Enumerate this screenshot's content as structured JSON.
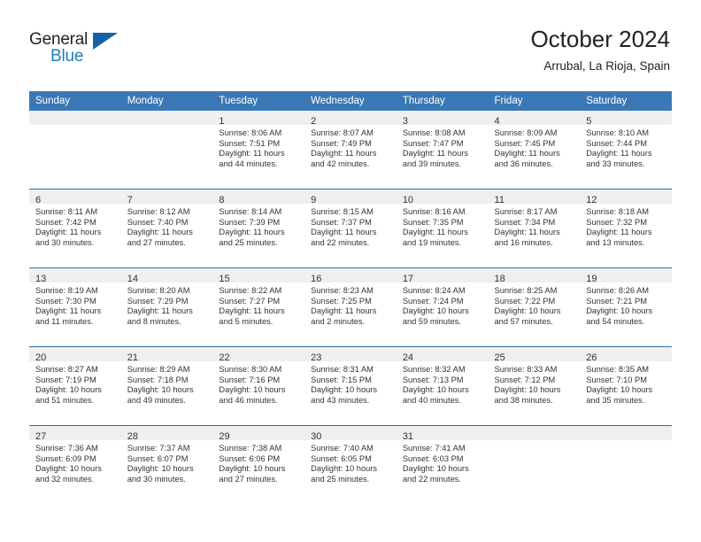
{
  "brand": {
    "word_one": "General",
    "word_two": "Blue",
    "triangle_icon": "triangle-icon"
  },
  "header": {
    "title": "October 2024",
    "subtitle": "Arrubal, La Rioja, Spain"
  },
  "colors": {
    "header_blue": "#3a78b5",
    "row_rule_blue": "#2e6da4",
    "daynum_band": "#efefef",
    "brand_blue": "#1a7fc1",
    "brand_dark": "#231f20"
  },
  "calendar": {
    "weekdays": [
      "Sunday",
      "Monday",
      "Tuesday",
      "Wednesday",
      "Thursday",
      "Friday",
      "Saturday"
    ],
    "weeks": [
      [
        {
          "day": "",
          "sunrise": "",
          "sunset": "",
          "daylight": "",
          "daylight2": ""
        },
        {
          "day": "",
          "sunrise": "",
          "sunset": "",
          "daylight": "",
          "daylight2": ""
        },
        {
          "day": "1",
          "sunrise": "Sunrise: 8:06 AM",
          "sunset": "Sunset: 7:51 PM",
          "daylight": "Daylight: 11 hours",
          "daylight2": "and 44 minutes."
        },
        {
          "day": "2",
          "sunrise": "Sunrise: 8:07 AM",
          "sunset": "Sunset: 7:49 PM",
          "daylight": "Daylight: 11 hours",
          "daylight2": "and 42 minutes."
        },
        {
          "day": "3",
          "sunrise": "Sunrise: 8:08 AM",
          "sunset": "Sunset: 7:47 PM",
          "daylight": "Daylight: 11 hours",
          "daylight2": "and 39 minutes."
        },
        {
          "day": "4",
          "sunrise": "Sunrise: 8:09 AM",
          "sunset": "Sunset: 7:45 PM",
          "daylight": "Daylight: 11 hours",
          "daylight2": "and 36 minutes."
        },
        {
          "day": "5",
          "sunrise": "Sunrise: 8:10 AM",
          "sunset": "Sunset: 7:44 PM",
          "daylight": "Daylight: 11 hours",
          "daylight2": "and 33 minutes."
        }
      ],
      [
        {
          "day": "6",
          "sunrise": "Sunrise: 8:11 AM",
          "sunset": "Sunset: 7:42 PM",
          "daylight": "Daylight: 11 hours",
          "daylight2": "and 30 minutes."
        },
        {
          "day": "7",
          "sunrise": "Sunrise: 8:12 AM",
          "sunset": "Sunset: 7:40 PM",
          "daylight": "Daylight: 11 hours",
          "daylight2": "and 27 minutes."
        },
        {
          "day": "8",
          "sunrise": "Sunrise: 8:14 AM",
          "sunset": "Sunset: 7:39 PM",
          "daylight": "Daylight: 11 hours",
          "daylight2": "and 25 minutes."
        },
        {
          "day": "9",
          "sunrise": "Sunrise: 8:15 AM",
          "sunset": "Sunset: 7:37 PM",
          "daylight": "Daylight: 11 hours",
          "daylight2": "and 22 minutes."
        },
        {
          "day": "10",
          "sunrise": "Sunrise: 8:16 AM",
          "sunset": "Sunset: 7:35 PM",
          "daylight": "Daylight: 11 hours",
          "daylight2": "and 19 minutes."
        },
        {
          "day": "11",
          "sunrise": "Sunrise: 8:17 AM",
          "sunset": "Sunset: 7:34 PM",
          "daylight": "Daylight: 11 hours",
          "daylight2": "and 16 minutes."
        },
        {
          "day": "12",
          "sunrise": "Sunrise: 8:18 AM",
          "sunset": "Sunset: 7:32 PM",
          "daylight": "Daylight: 11 hours",
          "daylight2": "and 13 minutes."
        }
      ],
      [
        {
          "day": "13",
          "sunrise": "Sunrise: 8:19 AM",
          "sunset": "Sunset: 7:30 PM",
          "daylight": "Daylight: 11 hours",
          "daylight2": "and 11 minutes."
        },
        {
          "day": "14",
          "sunrise": "Sunrise: 8:20 AM",
          "sunset": "Sunset: 7:29 PM",
          "daylight": "Daylight: 11 hours",
          "daylight2": "and 8 minutes."
        },
        {
          "day": "15",
          "sunrise": "Sunrise: 8:22 AM",
          "sunset": "Sunset: 7:27 PM",
          "daylight": "Daylight: 11 hours",
          "daylight2": "and 5 minutes."
        },
        {
          "day": "16",
          "sunrise": "Sunrise: 8:23 AM",
          "sunset": "Sunset: 7:25 PM",
          "daylight": "Daylight: 11 hours",
          "daylight2": "and 2 minutes."
        },
        {
          "day": "17",
          "sunrise": "Sunrise: 8:24 AM",
          "sunset": "Sunset: 7:24 PM",
          "daylight": "Daylight: 10 hours",
          "daylight2": "and 59 minutes."
        },
        {
          "day": "18",
          "sunrise": "Sunrise: 8:25 AM",
          "sunset": "Sunset: 7:22 PM",
          "daylight": "Daylight: 10 hours",
          "daylight2": "and 57 minutes."
        },
        {
          "day": "19",
          "sunrise": "Sunrise: 8:26 AM",
          "sunset": "Sunset: 7:21 PM",
          "daylight": "Daylight: 10 hours",
          "daylight2": "and 54 minutes."
        }
      ],
      [
        {
          "day": "20",
          "sunrise": "Sunrise: 8:27 AM",
          "sunset": "Sunset: 7:19 PM",
          "daylight": "Daylight: 10 hours",
          "daylight2": "and 51 minutes."
        },
        {
          "day": "21",
          "sunrise": "Sunrise: 8:29 AM",
          "sunset": "Sunset: 7:18 PM",
          "daylight": "Daylight: 10 hours",
          "daylight2": "and 49 minutes."
        },
        {
          "day": "22",
          "sunrise": "Sunrise: 8:30 AM",
          "sunset": "Sunset: 7:16 PM",
          "daylight": "Daylight: 10 hours",
          "daylight2": "and 46 minutes."
        },
        {
          "day": "23",
          "sunrise": "Sunrise: 8:31 AM",
          "sunset": "Sunset: 7:15 PM",
          "daylight": "Daylight: 10 hours",
          "daylight2": "and 43 minutes."
        },
        {
          "day": "24",
          "sunrise": "Sunrise: 8:32 AM",
          "sunset": "Sunset: 7:13 PM",
          "daylight": "Daylight: 10 hours",
          "daylight2": "and 40 minutes."
        },
        {
          "day": "25",
          "sunrise": "Sunrise: 8:33 AM",
          "sunset": "Sunset: 7:12 PM",
          "daylight": "Daylight: 10 hours",
          "daylight2": "and 38 minutes."
        },
        {
          "day": "26",
          "sunrise": "Sunrise: 8:35 AM",
          "sunset": "Sunset: 7:10 PM",
          "daylight": "Daylight: 10 hours",
          "daylight2": "and 35 minutes."
        }
      ],
      [
        {
          "day": "27",
          "sunrise": "Sunrise: 7:36 AM",
          "sunset": "Sunset: 6:09 PM",
          "daylight": "Daylight: 10 hours",
          "daylight2": "and 32 minutes."
        },
        {
          "day": "28",
          "sunrise": "Sunrise: 7:37 AM",
          "sunset": "Sunset: 6:07 PM",
          "daylight": "Daylight: 10 hours",
          "daylight2": "and 30 minutes."
        },
        {
          "day": "29",
          "sunrise": "Sunrise: 7:38 AM",
          "sunset": "Sunset: 6:06 PM",
          "daylight": "Daylight: 10 hours",
          "daylight2": "and 27 minutes."
        },
        {
          "day": "30",
          "sunrise": "Sunrise: 7:40 AM",
          "sunset": "Sunset: 6:05 PM",
          "daylight": "Daylight: 10 hours",
          "daylight2": "and 25 minutes."
        },
        {
          "day": "31",
          "sunrise": "Sunrise: 7:41 AM",
          "sunset": "Sunset: 6:03 PM",
          "daylight": "Daylight: 10 hours",
          "daylight2": "and 22 minutes."
        },
        {
          "day": "",
          "sunrise": "",
          "sunset": "",
          "daylight": "",
          "daylight2": ""
        },
        {
          "day": "",
          "sunrise": "",
          "sunset": "",
          "daylight": "",
          "daylight2": ""
        }
      ]
    ]
  }
}
